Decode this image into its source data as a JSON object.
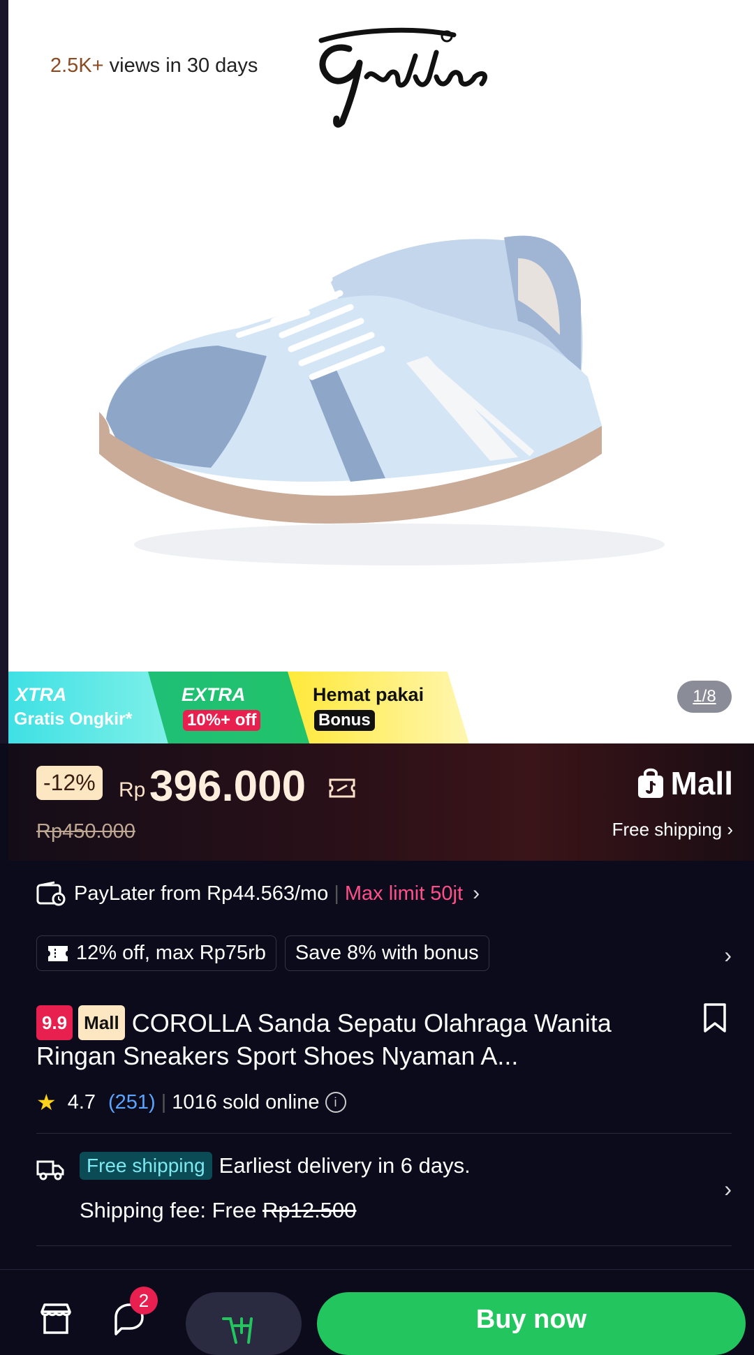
{
  "gallery": {
    "views_highlight": "2.5K+",
    "views_text": " views in 30 days",
    "counter": "1/8"
  },
  "promo": {
    "xtra_title": "XTRA",
    "xtra_sub": "Gratis Ongkir*",
    "extra_title": "EXTRA",
    "extra_sub": "10%+ off",
    "hemat_title": "Hemat pakai",
    "hemat_sub": "Bonus"
  },
  "price": {
    "discount": "-12%",
    "currency": "Rp",
    "current": "396.000",
    "original": "Rp450.000",
    "mall_label": "Mall",
    "free_shipping": "Free shipping ›"
  },
  "paylater": {
    "text": "PayLater from Rp44.563/mo",
    "separator": "|",
    "limit": "Max limit 50jt",
    "chevron": "›"
  },
  "vouchers": [
    {
      "label": "12% off, max Rp75rb"
    },
    {
      "label": "Save 8% with bonus"
    }
  ],
  "vouchers_chevron": "›",
  "product": {
    "badge_99": "9.9",
    "badge_mall": "Mall",
    "title": "COROLLA Sanda Sepatu Olahraga Wanita Ringan Sneakers Sport Shoes Nyaman A..."
  },
  "rating": {
    "star": "★",
    "score": "4.7",
    "count": "(251)",
    "separator": "|",
    "sold": "1016 sold online",
    "info": "i"
  },
  "shipping": {
    "badge": "Free shipping",
    "delivery": "Earliest delivery in 6 days.",
    "fee_label": "Shipping fee: Free ",
    "fee_original": "Rp12.500",
    "chevron": "›"
  },
  "bottom": {
    "chat_badge": "2",
    "buy_label": "Buy now"
  },
  "colors": {
    "buy_green": "#22c55e",
    "badge_red": "#e8204f",
    "link_blue": "#5aa5ff",
    "limit_pink": "#ff4f88"
  }
}
